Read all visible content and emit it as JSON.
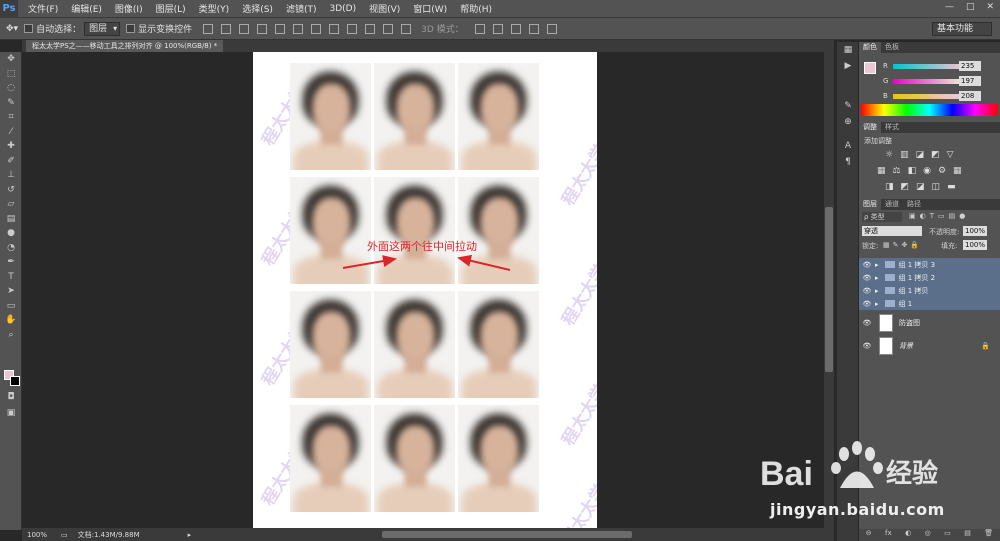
{
  "app": {
    "logo": "Ps"
  },
  "menu": [
    "文件(F)",
    "编辑(E)",
    "图像(I)",
    "图层(L)",
    "类型(Y)",
    "选择(S)",
    "滤镜(T)",
    "3D(D)",
    "视图(V)",
    "窗口(W)",
    "帮助(H)"
  ],
  "window_controls": [
    "—",
    "□",
    "✕"
  ],
  "options": {
    "auto_select_label": "自动选择：",
    "auto_select_value": "图层",
    "show_transform_label": "显示变换控件",
    "mode_3d": "3D 模式：",
    "workspace": "基本功能"
  },
  "document": {
    "tab_title": "程太太学PS之——移动工具之排列对齐 @ 100%(RGB/8) *"
  },
  "annotation": {
    "text": "外面这两个往中间拉动",
    "color": "#d8262a"
  },
  "watermark": {
    "text": "程太太学PS",
    "color": "#c9b3e8"
  },
  "status": {
    "zoom": "100%",
    "doc_info": "文档:1.43M/9.88M"
  },
  "color_panel": {
    "tabs": [
      "颜色",
      "色板"
    ],
    "r_label": "R",
    "r": "235",
    "g_label": "G",
    "g": "197",
    "b_label": "B",
    "b": "208",
    "fg_color": "#ebc5d0"
  },
  "adjust_panel": {
    "tabs": [
      "调整",
      "样式"
    ],
    "title": "添加调整"
  },
  "layers_panel": {
    "tabs": [
      "图层",
      "通道",
      "路径"
    ],
    "filter": "ρ 类型",
    "blend": "穿透",
    "opacity_label": "不透明度:",
    "opacity": "100%",
    "lock_label": "锁定:",
    "fill_label": "填充:",
    "fill": "100%",
    "layers": [
      {
        "name": "组 1 拷贝 3"
      },
      {
        "name": "组 1 拷贝 2"
      },
      {
        "name": "组 1 拷贝"
      },
      {
        "name": "组 1"
      },
      {
        "name": "防盗图"
      },
      {
        "name": "背景"
      }
    ],
    "bottom_icons": [
      "⊖",
      "fx",
      "◐",
      "◎",
      "▭",
      "▤",
      "🗑"
    ]
  },
  "watermark_brand": {
    "text": "jingyan.baidu.com",
    "brand": "Bai",
    "brand2": "经验"
  }
}
